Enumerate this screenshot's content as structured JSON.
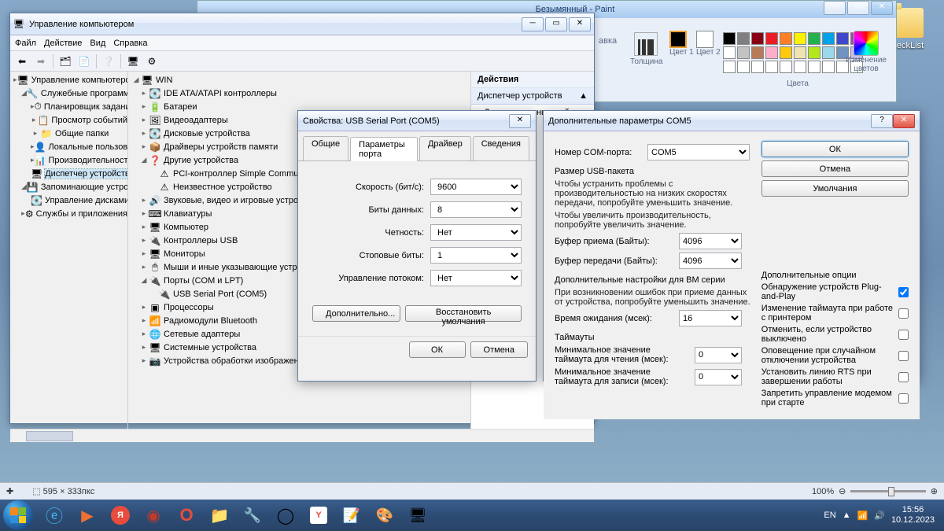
{
  "desktop": {
    "folder_label": "CheckList"
  },
  "paint": {
    "title": "Безымянный - Paint",
    "groups": {
      "tolshchina": "Толщина",
      "cvet1": "Цвет 1",
      "cvet2": "Цвет 2",
      "cveta": "Цвета",
      "izmenenie": "Изменение цветов",
      "vstavka": "авка"
    },
    "status": {
      "dims": "595 × 333пкс",
      "zoom": "100%"
    },
    "palette": [
      "#000",
      "#7f7f7f",
      "#880015",
      "#ed1c24",
      "#ff7f27",
      "#fff200",
      "#22b14c",
      "#00a2e8",
      "#3f48cc",
      "#a349a4",
      "#fff",
      "#c3c3c3",
      "#b97a57",
      "#ffaec9",
      "#ffc90e",
      "#efe4b0",
      "#b5e61d",
      "#99d9ea",
      "#7092be",
      "#c8bfe7",
      "#fff",
      "#fff",
      "#fff",
      "#fff",
      "#fff",
      "#fff",
      "#fff",
      "#fff",
      "#fff",
      "#fff"
    ]
  },
  "mgmt": {
    "title": "Управление компьютером",
    "menus": [
      "Файл",
      "Действие",
      "Вид",
      "Справка"
    ],
    "left_tree": [
      {
        "lvl": 0,
        "exp": "▸",
        "icon": "🖥",
        "label": "Управление компьютером (л"
      },
      {
        "lvl": 1,
        "exp": "◢",
        "icon": "🔧",
        "label": "Служебные программы"
      },
      {
        "lvl": 2,
        "exp": "▸",
        "icon": "⏱",
        "label": "Планировщик заданий"
      },
      {
        "lvl": 2,
        "exp": "▸",
        "icon": "📋",
        "label": "Просмотр событий"
      },
      {
        "lvl": 2,
        "exp": "▸",
        "icon": "📁",
        "label": "Общие папки"
      },
      {
        "lvl": 2,
        "exp": "▸",
        "icon": "👤",
        "label": "Локальные пользова"
      },
      {
        "lvl": 2,
        "exp": "▸",
        "icon": "📊",
        "label": "Производительності"
      },
      {
        "lvl": 2,
        "exp": "",
        "icon": "🖥",
        "label": "Диспетчер устройств",
        "sel": true
      },
      {
        "lvl": 1,
        "exp": "◢",
        "icon": "💾",
        "label": "Запоминающие устройс"
      },
      {
        "lvl": 2,
        "exp": "",
        "icon": "💽",
        "label": "Управление дисками"
      },
      {
        "lvl": 1,
        "exp": "▸",
        "icon": "⚙",
        "label": "Службы и приложения"
      }
    ],
    "dev_tree": [
      {
        "lvl": 0,
        "exp": "◢",
        "icon": "🖥",
        "label": "WIN"
      },
      {
        "lvl": 1,
        "exp": "▸",
        "icon": "💽",
        "label": "IDE ATA/ATAPI контроллеры"
      },
      {
        "lvl": 1,
        "exp": "▸",
        "icon": "🔋",
        "label": "Батареи"
      },
      {
        "lvl": 1,
        "exp": "▸",
        "icon": "🖼",
        "label": "Видеоадаптеры"
      },
      {
        "lvl": 1,
        "exp": "▸",
        "icon": "💽",
        "label": "Дисковые устройства"
      },
      {
        "lvl": 1,
        "exp": "▸",
        "icon": "📦",
        "label": "Драйверы устройств памяти"
      },
      {
        "lvl": 1,
        "exp": "◢",
        "icon": "❓",
        "label": "Другие устройства"
      },
      {
        "lvl": 2,
        "exp": "",
        "icon": "⚠",
        "label": "PCI-контроллер Simple Communica"
      },
      {
        "lvl": 2,
        "exp": "",
        "icon": "⚠",
        "label": "Неизвестное устройство"
      },
      {
        "lvl": 1,
        "exp": "▸",
        "icon": "🔊",
        "label": "Звуковые, видео и игровые устройст"
      },
      {
        "lvl": 1,
        "exp": "▸",
        "icon": "⌨",
        "label": "Клавиатуры"
      },
      {
        "lvl": 1,
        "exp": "▸",
        "icon": "🖥",
        "label": "Компьютер"
      },
      {
        "lvl": 1,
        "exp": "▸",
        "icon": "🔌",
        "label": "Контроллеры USB"
      },
      {
        "lvl": 1,
        "exp": "▸",
        "icon": "🖥",
        "label": "Мониторы"
      },
      {
        "lvl": 1,
        "exp": "▸",
        "icon": "🖱",
        "label": "Мыши и иные указывающие устройст"
      },
      {
        "lvl": 1,
        "exp": "◢",
        "icon": "🔌",
        "label": "Порты (COM и LPT)"
      },
      {
        "lvl": 2,
        "exp": "",
        "icon": "🔌",
        "label": "USB Serial Port (COM5)"
      },
      {
        "lvl": 1,
        "exp": "▸",
        "icon": "▣",
        "label": "Процессоры"
      },
      {
        "lvl": 1,
        "exp": "▸",
        "icon": "📶",
        "label": "Радиомодули Bluetooth"
      },
      {
        "lvl": 1,
        "exp": "▸",
        "icon": "🌐",
        "label": "Сетевые адаптеры"
      },
      {
        "lvl": 1,
        "exp": "▸",
        "icon": "🖥",
        "label": "Системные устройства"
      },
      {
        "lvl": 1,
        "exp": "▸",
        "icon": "📷",
        "label": "Устройства обработки изображений"
      }
    ],
    "actions": {
      "hdr": "Действия",
      "section": "Диспетчер устройств",
      "more": "Дополнительные дей..."
    }
  },
  "props": {
    "title": "Свойства: USB Serial Port (COM5)",
    "tabs": [
      "Общие",
      "Параметры порта",
      "Драйвер",
      "Сведения"
    ],
    "active_tab": 1,
    "fields": {
      "speed": {
        "label": "Скорость (бит/с):",
        "value": "9600"
      },
      "databits": {
        "label": "Биты данных:",
        "value": "8"
      },
      "parity": {
        "label": "Четность:",
        "value": "Нет"
      },
      "stopbits": {
        "label": "Стоповые биты:",
        "value": "1"
      },
      "flow": {
        "label": "Управление потоком:",
        "value": "Нет"
      }
    },
    "advanced_btn": "Дополнительно...",
    "restore_btn": "Восстановить умолчания",
    "ok": "ОК",
    "cancel": "Отмена"
  },
  "adv": {
    "title": "Дополнительные параметры COM5",
    "comport": {
      "label": "Номер COM-порта:",
      "value": "COM5"
    },
    "packet": {
      "title": "Размер USB-пакета",
      "note1": "Чтобы устранить проблемы с производительностью на низких скоростях передачи, попробуйте уменьшить значение.",
      "note2": "Чтобы увеличить производительность, попробуйте увеличить значение.",
      "rx": {
        "label": "Буфер приема (Байты):",
        "value": "4096"
      },
      "tx": {
        "label": "Буфер передачи (Байты):",
        "value": "4096"
      }
    },
    "bm": {
      "title": "Дополнительные настройки для BM серии",
      "note": "При возникновении ошибок при приеме данных от устройства, попробуйте уменьшить значение.",
      "latency": {
        "label": "Время ожидания (мсек):",
        "value": "16"
      }
    },
    "timeouts": {
      "title": "Таймауты",
      "read": {
        "label": "Минимальное значение таймаута для чтения (мсек):",
        "value": "0"
      },
      "write": {
        "label": "Минимальное значение таймаута для записи (мсек):",
        "value": "0"
      }
    },
    "opts": {
      "title": "Дополнительные опции",
      "items": [
        {
          "label": "Обнаружение устройств Plug-and-Play",
          "checked": true
        },
        {
          "label": "Изменение таймаута при работе с принтером",
          "checked": false
        },
        {
          "label": "Отменить, если устройство выключено",
          "checked": false
        },
        {
          "label": "Оповещение при случайном отключении устройства",
          "checked": false
        },
        {
          "label": "Установить линию RTS при завершении работы",
          "checked": false
        },
        {
          "label": "Запретить управление модемом при старте",
          "checked": false
        }
      ]
    },
    "ok": "ОК",
    "cancel": "Отмена",
    "defaults": "Умолчания"
  },
  "tray": {
    "lang": "EN",
    "time": "15:56",
    "date": "10.12.2023"
  }
}
